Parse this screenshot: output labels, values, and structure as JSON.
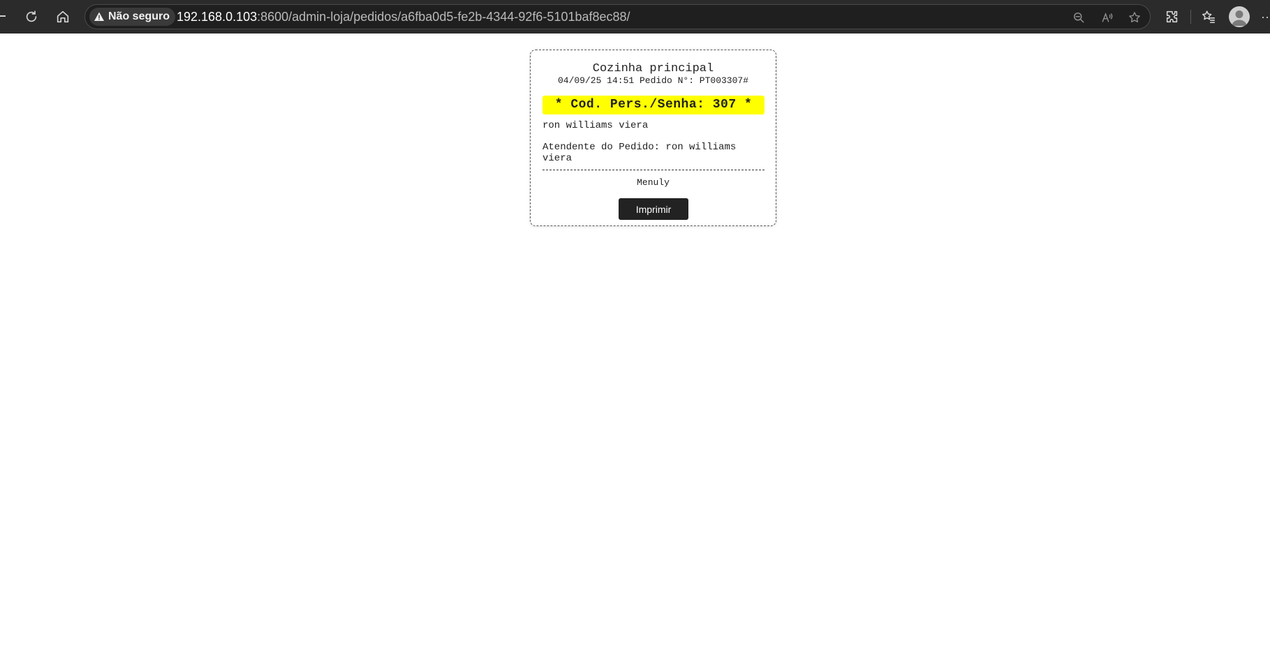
{
  "browser": {
    "security_label": "Não seguro",
    "url_host": "192.168.0.103",
    "url_rest": ":8600/admin-loja/pedidos/a6fba0d5-fe2b-4344-92f6-5101baf8ec88/",
    "icons": [
      "back-icon",
      "reload-icon",
      "home-icon",
      "warning-icon",
      "zoom-icon",
      "read-aloud-icon",
      "favorite-star-icon",
      "extensions-icon",
      "favorites-icon",
      "profile-avatar",
      "more-icon"
    ]
  },
  "receipt": {
    "title": "Cozinha principal",
    "meta": "04/09/25 14:51 Pedido N°: PT003307#",
    "code": "* Cod. Pers./Senha: 307 *",
    "customer": "ron williams viera",
    "attendant": "Atendente do Pedido: ron williams viera",
    "footer": "Menuly",
    "print_label": "Imprimir",
    "highlight_color": "#ffff00"
  }
}
